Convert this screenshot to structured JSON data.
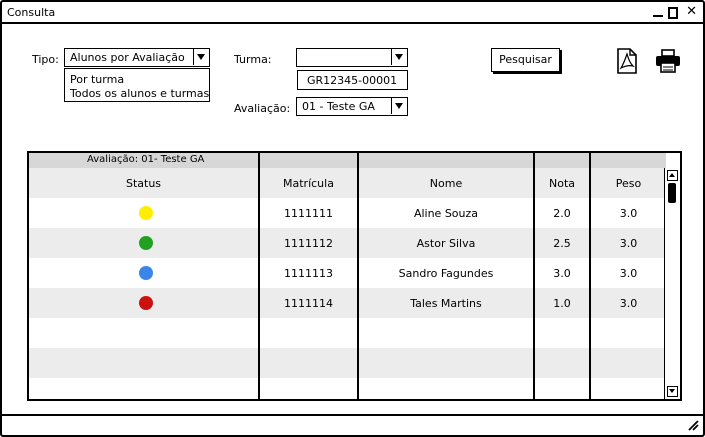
{
  "window": {
    "title": "Consulta"
  },
  "filters": {
    "tipo_label": "Tipo:",
    "tipo_value": "Alunos por Avaliação",
    "tipo_options": [
      "Por turma",
      "Todos os alunos e turmas"
    ],
    "turma_label": "Turma:",
    "turma_value": "",
    "turma_code": "GR12345-00001",
    "avaliacao_label": "Avaliação:",
    "avaliacao_value": "01 - Teste GA",
    "search_button": "Pesquisar"
  },
  "toolbar": {
    "icons": [
      "pdf-icon",
      "print-icon"
    ]
  },
  "table": {
    "group_label": "Avaliação: 01- Teste GA",
    "columns": [
      "Status",
      "Matrícula",
      "Nome",
      "Nota",
      "Peso"
    ],
    "rows": [
      {
        "status_color": "#ffee00",
        "matricula": "1111111",
        "nome": "Aline Souza",
        "nota": "2.0",
        "peso": "3.0"
      },
      {
        "status_color": "#22a022",
        "matricula": "1111112",
        "nome": "Astor Silva",
        "nota": "2.5",
        "peso": "3.0"
      },
      {
        "status_color": "#3a86e8",
        "matricula": "1111113",
        "nome": "Sandro Fagundes",
        "nota": "3.0",
        "peso": "3.0"
      },
      {
        "status_color": "#cc1111",
        "matricula": "1111114",
        "nome": "Tales Martins",
        "nota": "1.0",
        "peso": "3.0"
      }
    ]
  }
}
